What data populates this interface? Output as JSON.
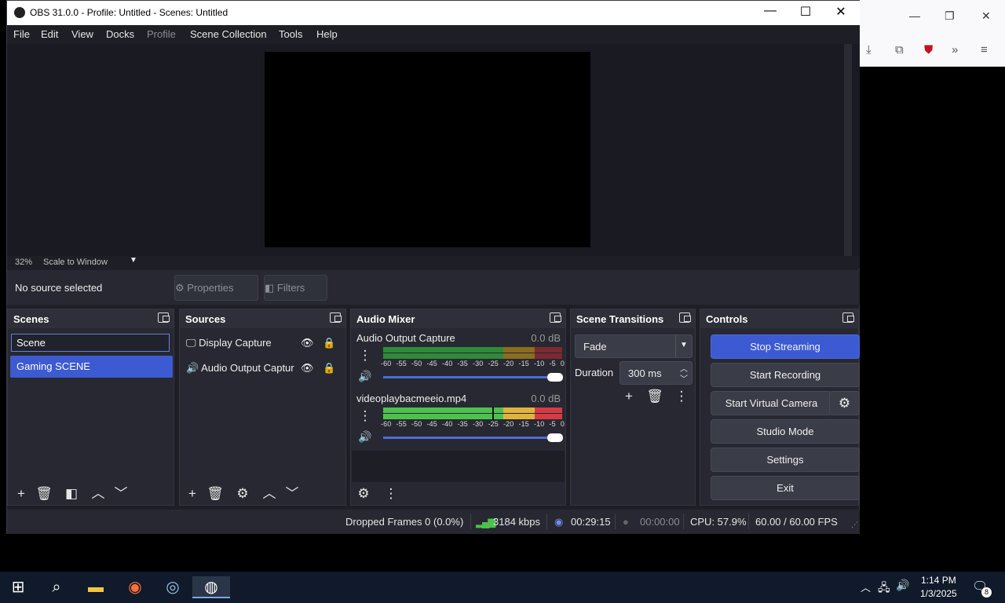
{
  "window": {
    "title": "OBS 31.0.0 - Profile: Untitled - Scenes: Untitled"
  },
  "menu": [
    "File",
    "Edit",
    "View",
    "Docks",
    "Profile",
    "Scene Collection",
    "Tools",
    "Help"
  ],
  "preview": {
    "zoom": "32%",
    "scale_mode": "Scale to Window"
  },
  "source_bar": {
    "status": "No source selected",
    "properties": "Properties",
    "filters": "Filters"
  },
  "scenes": {
    "title": "Scenes",
    "items": [
      "Scene",
      "Gaming SCENE"
    ],
    "selected": "Gaming SCENE"
  },
  "sources": {
    "title": "Sources",
    "items": [
      "Display Capture",
      "Audio Output Captur"
    ]
  },
  "mixer": {
    "title": "Audio Mixer",
    "channels": [
      {
        "name": "Audio Output Capture",
        "db": "0.0 dB",
        "level": 0.0
      },
      {
        "name": "videoplaybacmeeio.mp4",
        "db": "0.0 dB",
        "level": 0.6
      }
    ],
    "scale": [
      "-60",
      "-55",
      "-50",
      "-45",
      "-40",
      "-35",
      "-30",
      "-25",
      "-20",
      "-15",
      "-10",
      "-5",
      "0"
    ]
  },
  "transitions": {
    "title": "Scene Transitions",
    "selected": "Fade",
    "duration_label": "Duration",
    "duration": "300 ms"
  },
  "controls": {
    "title": "Controls",
    "stop_streaming": "Stop Streaming",
    "start_recording": "Start Recording",
    "start_virtual_camera": "Start Virtual Camera",
    "studio_mode": "Studio Mode",
    "settings": "Settings",
    "exit": "Exit"
  },
  "status": {
    "dropped": "Dropped Frames 0 (0.0%)",
    "bitrate": "3184 kbps",
    "stream_time": "00:29:15",
    "rec_time": "00:00:00",
    "cpu": "CPU: 57.9%",
    "fps": "60.00 / 60.00 FPS"
  },
  "taskbar": {
    "time": "1:14 PM",
    "date": "1/3/2025",
    "notifications": "8"
  },
  "colors": {
    "accent": "#3c5ad1",
    "panel": "#272831",
    "bg": "#1e1f26"
  }
}
